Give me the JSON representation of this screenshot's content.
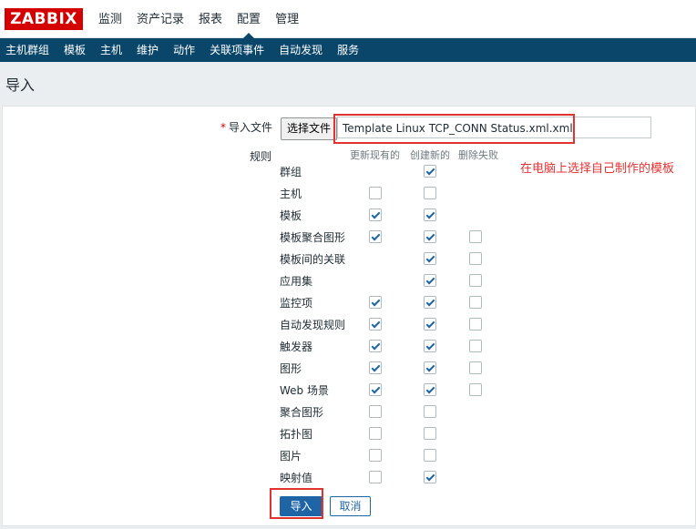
{
  "logo": "ZABBIX",
  "top_nav": [
    "监测",
    "资产记录",
    "报表",
    "配置",
    "管理"
  ],
  "sub_nav": [
    "主机群组",
    "模板",
    "主机",
    "维护",
    "动作",
    "关联项事件",
    "自动发现",
    "服务"
  ],
  "page": {
    "title": "导入"
  },
  "form": {
    "required_mark": "*",
    "file_label": "导入文件",
    "choose_file_button": "选择文件",
    "file_name": "Template Linux TCP_CONN Status.xml.xml",
    "rules_label": "规则",
    "columns": [
      "更新现有的",
      "创建新的",
      "删除失败"
    ],
    "rules": [
      {
        "name": "群组",
        "update": null,
        "create": true,
        "delete": null
      },
      {
        "name": "主机",
        "update": false,
        "create": false,
        "delete": null
      },
      {
        "name": "模板",
        "update": true,
        "create": true,
        "delete": null
      },
      {
        "name": "模板聚合图形",
        "update": true,
        "create": true,
        "delete": false
      },
      {
        "name": "模板间的关联",
        "update": null,
        "create": true,
        "delete": false
      },
      {
        "name": "应用集",
        "update": null,
        "create": true,
        "delete": false
      },
      {
        "name": "监控项",
        "update": true,
        "create": true,
        "delete": false
      },
      {
        "name": "自动发现规则",
        "update": true,
        "create": true,
        "delete": false
      },
      {
        "name": "触发器",
        "update": true,
        "create": true,
        "delete": false
      },
      {
        "name": "图形",
        "update": true,
        "create": true,
        "delete": false
      },
      {
        "name": "Web 场景",
        "update": true,
        "create": true,
        "delete": false
      },
      {
        "name": "聚合图形",
        "update": false,
        "create": false,
        "delete": null
      },
      {
        "name": "拓扑图",
        "update": false,
        "create": false,
        "delete": null
      },
      {
        "name": "图片",
        "update": false,
        "create": false,
        "delete": null
      },
      {
        "name": "映射值",
        "update": false,
        "create": true,
        "delete": null
      }
    ],
    "import_button": "导入",
    "cancel_button": "取消"
  },
  "annotation": "在电脑上选择自己制作的模板",
  "colors": {
    "brand": "#d40000",
    "subnav_bg": "#0a466a",
    "accent": "#1f65a6",
    "highlight": "#e33232"
  }
}
